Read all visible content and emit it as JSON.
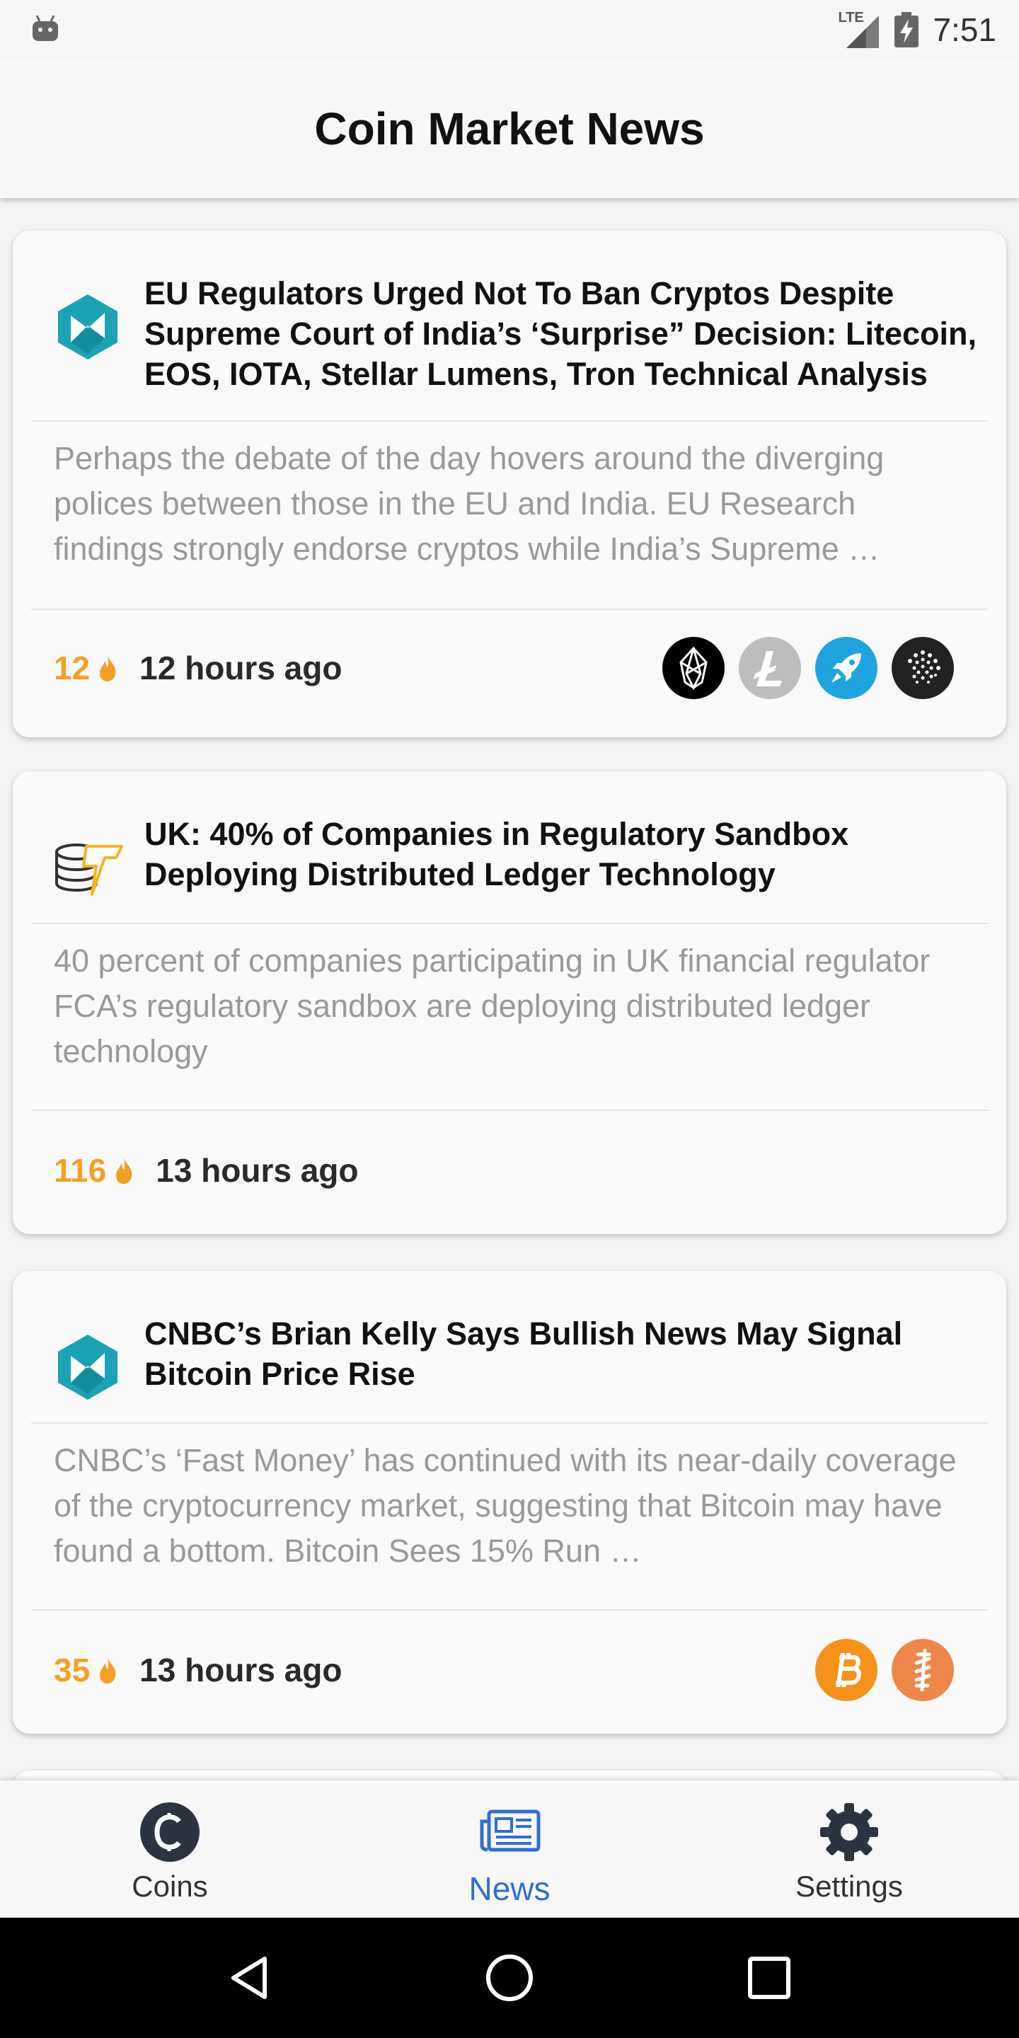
{
  "status_bar": {
    "network": "LTE",
    "time": "7:51"
  },
  "app": {
    "title": "Coin Market News"
  },
  "articles": [
    {
      "source_icon": "newsbtc-logo-icon",
      "headline": "EU Regulators Urged Not To Ban Cryptos Despite Supreme Court of India’s ‘Surprise” Decision: Litecoin, EOS, IOTA, Stellar Lumens, Tron Technical Analysis",
      "summary": "Perhaps the debate of the day hovers around the diverging polices between those in the EU and India. EU Research findings strongly endorse cryptos while India’s Supreme …",
      "hot_count": "12",
      "time_ago": "12 hours ago",
      "coins": [
        "eos-icon",
        "litecoin-icon",
        "stellar-rocket-icon",
        "iota-icon"
      ]
    },
    {
      "source_icon": "coinspeaker-logo-icon",
      "headline": "UK: 40% of Companies in Regulatory Sandbox Deploying Distributed Ledger Technology",
      "summary": "40 percent of companies participating in UK financial regulator FCA’s regulatory sandbox are deploying distributed ledger technology",
      "hot_count": "116",
      "time_ago": "13 hours ago",
      "coins": []
    },
    {
      "source_icon": "newsbtc-logo-icon",
      "headline": "CNBC’s Brian Kelly Says Bullish News May Signal Bitcoin Price Rise",
      "summary": "CNBC’s ‘Fast Money’ has continued with its near-daily coverage of the cryptocurrency market, suggesting that Bitcoin may have found a bottom. Bitcoin Sees 15% Run …",
      "hot_count": "35",
      "time_ago": "13 hours ago",
      "coins": [
        "bitcoin-icon",
        "bitcoin-cash-icon"
      ]
    }
  ],
  "bottom_nav": {
    "items": [
      {
        "label": "Coins",
        "icon": "coin-icon",
        "active": false
      },
      {
        "label": "News",
        "icon": "newspaper-icon",
        "active": true
      },
      {
        "label": "Settings",
        "icon": "gear-icon",
        "active": false
      }
    ]
  },
  "colors": {
    "accent_orange": "#f5a023",
    "active_blue": "#2f6fd6",
    "newsbtc_teal": "#1aa3b5",
    "bitcoin_orange": "#f7931a",
    "stellar_blue": "#1ea5e0"
  }
}
